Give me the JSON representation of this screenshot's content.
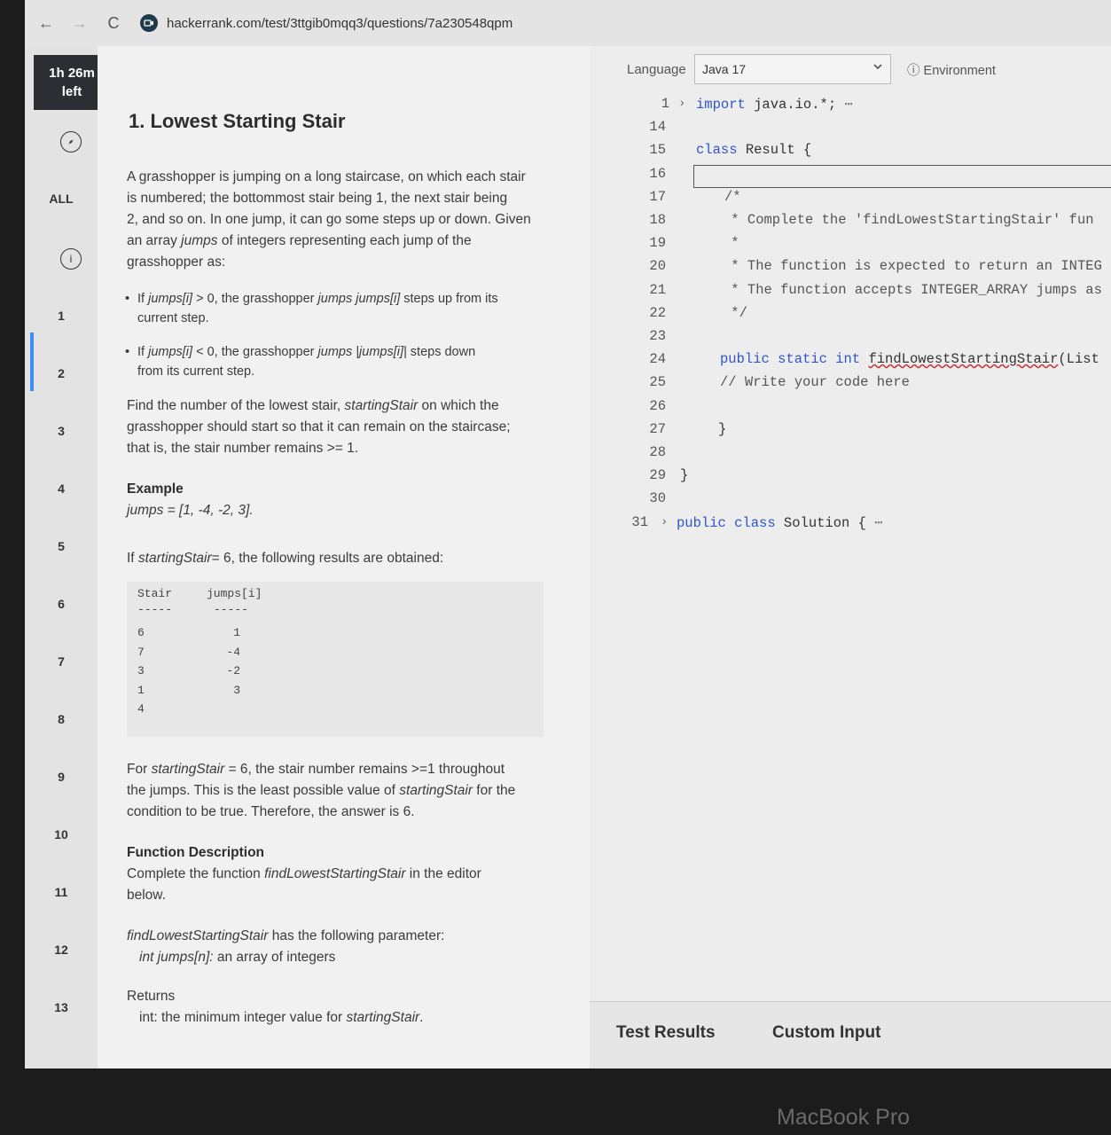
{
  "browser": {
    "back_icon": "←",
    "forward_icon": "→",
    "reload_icon": "C",
    "url": "hackerrank.com/test/3ttgib0mqq3/questions/7a230548qpm"
  },
  "sidebar": {
    "timer_line1": "1h 26m",
    "timer_line2": "left",
    "all_label": "ALL",
    "info_icon": "i",
    "questions": [
      "1",
      "2",
      "3",
      "4",
      "5",
      "6",
      "7",
      "8",
      "9",
      "10",
      "11",
      "12",
      "13"
    ]
  },
  "problem": {
    "title": "1. Lowest Starting Stair",
    "intro_1": "A grasshopper is jumping on a long staircase, on which each stair",
    "intro_2": "is numbered; the bottommost stair being 1, the next stair being",
    "intro_3": "2, and so on. In one jump, it can go some steps up or down. Given",
    "intro_4": "an array jumps of integers representing each jump of the",
    "intro_5": "grasshopper as:",
    "bullet_1a": "If jumps[i] > 0, the grasshopper jumps jumps[i] steps up from its",
    "bullet_1b": "current step.",
    "bullet_2a": "If jumps[i] < 0, the grasshopper jumps |jumps[i]| steps down",
    "bullet_2b": "from its current step.",
    "find_1": "Find the number of the lowest stair, startingStair on which the",
    "find_2": "grasshopper should start so that it can remain on the staircase;",
    "find_3": "that is, the stair number remains >= 1.",
    "example_heading": "Example",
    "example_value": "jumps = [1, -4, -2, 3].",
    "if_text": "If startingStair= 6, the following results are obtained:",
    "table": {
      "col1": "Stair",
      "col2": "jumps[i]",
      "sep1": "-----",
      "sep2": "-----",
      "rows": [
        {
          "stair": "6",
          "jump": "1"
        },
        {
          "stair": "7",
          "jump": "-4"
        },
        {
          "stair": "3",
          "jump": "-2"
        },
        {
          "stair": "1",
          "jump": "3"
        },
        {
          "stair": "4",
          "jump": ""
        }
      ]
    },
    "for_1": "For startingStair = 6, the stair number remains >=1 throughout",
    "for_2": "the jumps. This is the least possible value of startingStair for the",
    "for_3": "condition to be true. Therefore, the answer is 6.",
    "func_heading": "Function Description",
    "func_1": "Complete the function findLowestStartingStair in the editor",
    "func_2": "below.",
    "param_1": "findLowestStartingStair has the following parameter:",
    "param_2": "int jumps[n]:  an array of integers",
    "returns_heading": "Returns",
    "returns_1": "int: the minimum integer value for startingStair."
  },
  "editor": {
    "language_label": "Language",
    "language_value": "Java 17",
    "environment_label": "ⓘ Environment",
    "lines": [
      {
        "n": "1",
        "fold": true,
        "text": "import java.io.*;",
        "suffix": " ⋯",
        "kind": "import",
        "indent": 0
      },
      {
        "n": "14",
        "fold": false,
        "text": "",
        "suffix": "",
        "kind": "plain",
        "indent": 0
      },
      {
        "n": "15",
        "fold": false,
        "text": "class Result {",
        "suffix": "",
        "kind": "class",
        "indent": 0
      },
      {
        "n": "16",
        "fold": false,
        "text": "",
        "suffix": "",
        "kind": "plain",
        "indent": 0
      },
      {
        "n": "17",
        "fold": false,
        "text": "/*",
        "suffix": "",
        "kind": "comment",
        "indent": 1
      },
      {
        "n": "18",
        "fold": false,
        "text": " * Complete the 'findLowestStartingStair' fun",
        "suffix": "",
        "kind": "comment",
        "indent": 1
      },
      {
        "n": "19",
        "fold": false,
        "text": " *",
        "suffix": "",
        "kind": "comment",
        "indent": 1
      },
      {
        "n": "20",
        "fold": false,
        "text": " * The function is expected to return an INTEG",
        "suffix": "",
        "kind": "comment",
        "indent": 1
      },
      {
        "n": "21",
        "fold": false,
        "text": " * The function accepts INTEGER_ARRAY jumps as",
        "suffix": "",
        "kind": "comment",
        "indent": 1
      },
      {
        "n": "22",
        "fold": false,
        "text": " */",
        "suffix": "",
        "kind": "comment",
        "indent": 1
      },
      {
        "n": "23",
        "fold": false,
        "text": "",
        "suffix": "",
        "kind": "plain",
        "indent": 0
      },
      {
        "n": "24",
        "fold": false,
        "text": "public static int findLowestStartingStair(List",
        "suffix": "",
        "kind": "method",
        "indent": 1
      },
      {
        "n": "25",
        "fold": false,
        "text": "// Write your code here",
        "suffix": "",
        "kind": "comment",
        "indent": 1
      },
      {
        "n": "26",
        "fold": false,
        "text": "",
        "suffix": "",
        "kind": "plain",
        "indent": 0
      },
      {
        "n": "27",
        "fold": false,
        "text": "}",
        "suffix": "",
        "kind": "plain",
        "indent": 1
      },
      {
        "n": "28",
        "fold": false,
        "text": "",
        "suffix": "",
        "kind": "plain",
        "indent": 0
      },
      {
        "n": "29",
        "fold": false,
        "text": "}",
        "suffix": "",
        "kind": "plain",
        "indent": 0
      },
      {
        "n": "30",
        "fold": false,
        "text": "",
        "suffix": "",
        "kind": "plain",
        "indent": 0
      },
      {
        "n": "31",
        "fold": true,
        "text": "public class Solution {",
        "suffix": " ⋯",
        "kind": "solution",
        "indent": 0
      }
    ],
    "tab_test_results": "Test Results",
    "tab_custom_input": "Custom Input"
  },
  "device_label": "MacBook Pro"
}
